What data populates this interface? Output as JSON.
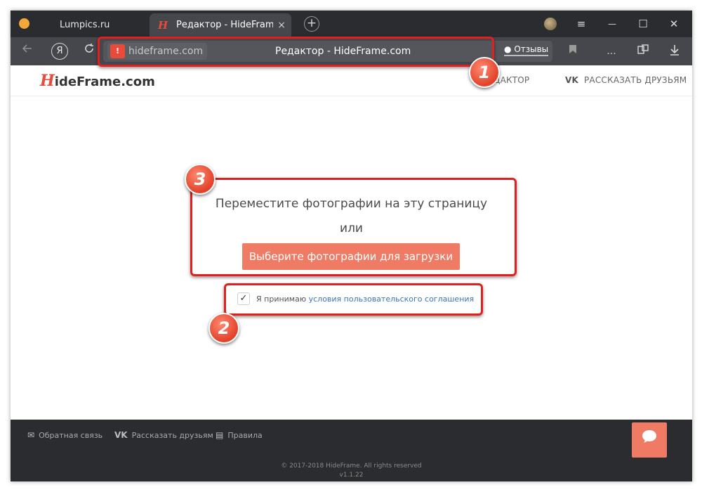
{
  "browser": {
    "tabs": [
      {
        "label": "Lumpics.ru",
        "active": false
      },
      {
        "label": "Редактор - HideFrame.com",
        "active": true
      }
    ],
    "new_tab_symbol": "+",
    "tab_close_symbol": "×",
    "window_controls": {
      "menu": "≡",
      "minimize": "—",
      "maximize": "☐",
      "close": "✕"
    },
    "address": {
      "site_chip": "hideframe.com",
      "page_title": "Редактор - HideFrame.com",
      "warning_badge": "!"
    },
    "reviews_label": "Отзывы",
    "more_label": "...",
    "icons": {
      "back": "back-arrow-icon",
      "yandex": "yandex-icon",
      "reload": "reload-icon",
      "bookmark": "bookmark-icon",
      "extensions": "extensions-icon",
      "download": "download-icon"
    },
    "yandex_letter": "Я"
  },
  "site": {
    "logo_letter": "H",
    "logo_rest": "ideFrame.com",
    "nav": {
      "editor_label": "ДАКТОР",
      "share_prefix": "VK",
      "share_label": "РАССКАЗАТЬ ДРУЗЬЯМ"
    }
  },
  "upload": {
    "drop_text": "Переместите фотографии на эту страницу",
    "or_text": "или",
    "button_label": "Выберите фотографии для загрузки",
    "agree_prefix": "Я принимаю",
    "agree_link": "условия пользовательского соглашения",
    "agreed": true,
    "checkmark": "✓"
  },
  "footer": {
    "links": [
      {
        "label": "Обратная связь",
        "icon": "✉"
      },
      {
        "label": "Рассказать друзьям",
        "icon": "VK"
      },
      {
        "label": "Правила",
        "icon": "▤"
      }
    ],
    "copyright": "© 2017-2018 HideFrame. All rights reserved",
    "version": "v1.1.22",
    "chat_icon": "💬"
  },
  "annotations": [
    {
      "number": "1"
    },
    {
      "number": "2"
    },
    {
      "number": "3"
    }
  ],
  "colors": {
    "accent": "#ef7b65",
    "annotation_red": "#e0201e",
    "browser_dark": "#2b2c30",
    "link_blue": "#3a74b8"
  }
}
